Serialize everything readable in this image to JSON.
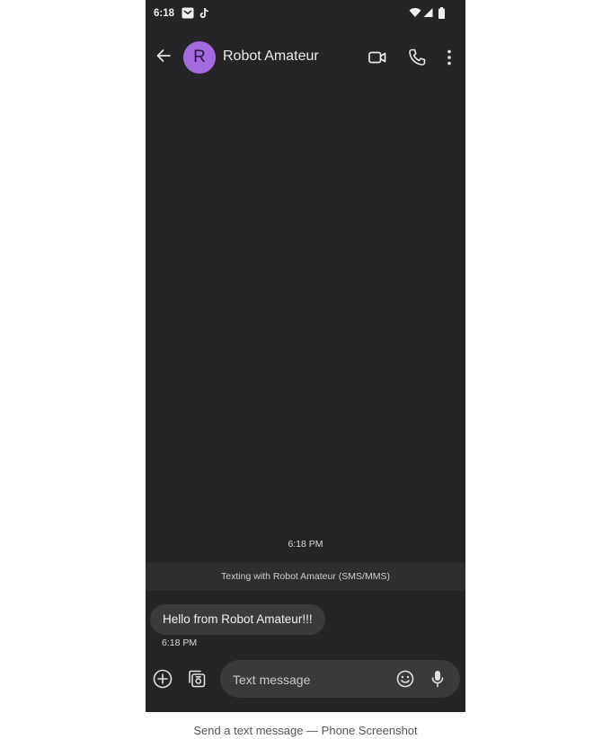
{
  "status_bar": {
    "time": "6:18",
    "notification_icons": [
      "gmail-icon",
      "tiktok-icon"
    ],
    "system_icons": [
      "wifi-icon",
      "cellular-signal-icon",
      "battery-icon"
    ]
  },
  "app_bar": {
    "avatar_initial": "R",
    "avatar_color": "#a46ae0",
    "contact_name": "Robot Amateur",
    "actions": [
      "video-call-icon",
      "phone-call-icon",
      "more-options-icon"
    ]
  },
  "conversation": {
    "timestamp": "6:18 PM",
    "banner": "Texting with Robot Amateur (SMS/MMS)",
    "messages": [
      {
        "text": "Hello from Robot Amateur!!!",
        "time": "6:18 PM",
        "direction": "incoming"
      }
    ]
  },
  "composer": {
    "placeholder": "Text message",
    "value": ""
  },
  "caption": "Send a text message — Phone Screenshot"
}
